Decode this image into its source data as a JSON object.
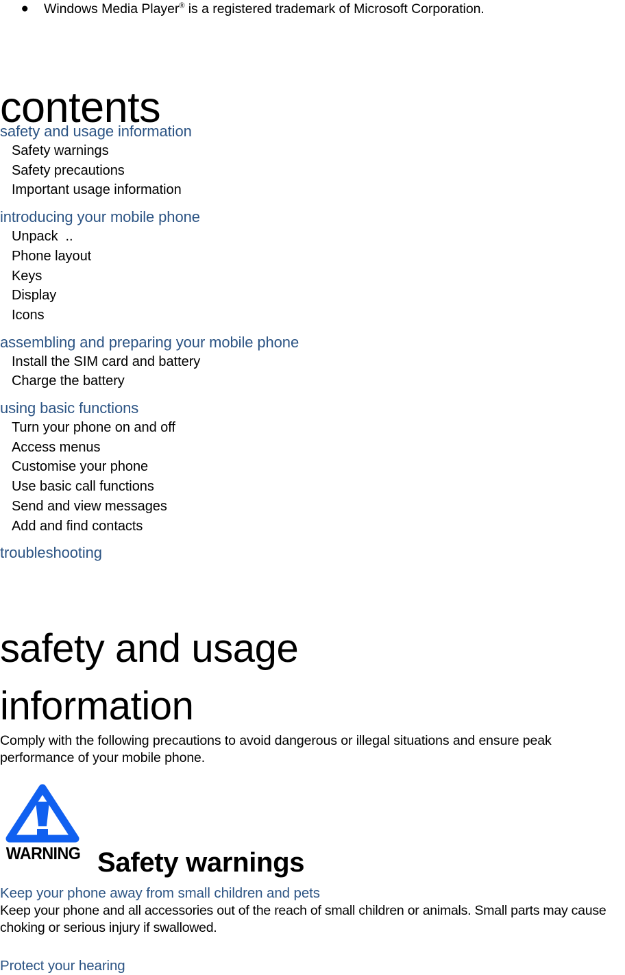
{
  "trademark_note": {
    "bullet": "●",
    "text_before": "Windows Media Player",
    "superscript": "®",
    "text_after": " is a registered trademark of Microsoft Corporation."
  },
  "contents": {
    "title": "contents",
    "groups": [
      {
        "heading": "safety and usage information",
        "items": [
          "Safety warnings",
          "Safety precautions",
          "Important usage information"
        ]
      },
      {
        "heading": "introducing your mobile phone",
        "items": [
          "Unpack  ..",
          "Phone layout",
          "Keys",
          "Display",
          "Icons"
        ]
      },
      {
        "heading": "assembling and preparing your mobile phone",
        "items": [
          "Install the SIM card and battery",
          "Charge the battery"
        ]
      },
      {
        "heading": "using basic functions",
        "items": [
          "Turn your phone on and off",
          "Access menus",
          "Customise your phone",
          "Use basic call functions",
          "Send and view messages",
          "Add and find contacts"
        ]
      },
      {
        "heading": "troubleshooting",
        "items": []
      }
    ]
  },
  "safety_chapter": {
    "title": "safety and usage information",
    "intro": "Comply with the following precautions to avoid dangerous or illegal situations and ensure peak performance of your mobile phone.",
    "warning_badge": {
      "label": "WARNING",
      "icon": "warning-triangle-icon"
    },
    "section_heading": "Safety warnings",
    "subsections": [
      {
        "title": "Keep your phone away from small children and pets",
        "body": "Keep your phone and all accessories out of the reach of small children or animals. Small parts may cause choking or serious injury if swallowed."
      },
      {
        "title": "Protect your hearing",
        "body": ""
      }
    ]
  },
  "colors": {
    "heading_blue": "#2c5484",
    "warning_blue": "#1060f0",
    "body_black": "#000000",
    "page_background": "#ffffff"
  }
}
